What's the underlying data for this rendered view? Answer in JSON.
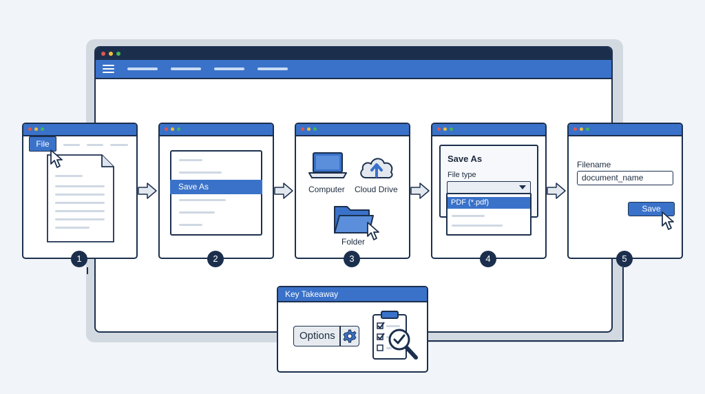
{
  "steps": [
    {
      "number": "1",
      "file_menu_label": "File"
    },
    {
      "number": "2",
      "menu_highlight": "Save As"
    },
    {
      "number": "3",
      "location_computer": "Computer",
      "location_cloud": "Cloud Drive",
      "location_folder": "Folder"
    },
    {
      "number": "4",
      "dialog_title": "Save As",
      "file_type_label": "File type",
      "selected_option": "PDF (*.pdf)"
    },
    {
      "number": "5",
      "filename_label": "Filename",
      "filename_value": "document_name",
      "save_button": "Save"
    }
  ],
  "takeaway": {
    "header": "Key Takeaway",
    "options_button": "Options"
  },
  "colors": {
    "navy": "#1b2f4d",
    "accent_blue": "#3a72c9",
    "page_background": "#f1f4f8"
  },
  "icons": [
    "hamburger-icon",
    "document-icon",
    "cursor-icon",
    "laptop-icon",
    "cloud-upload-icon",
    "folder-icon",
    "dropdown-caret-icon",
    "gear-icon",
    "checklist-clipboard-icon",
    "magnifier-check-icon",
    "arrow-right-icon"
  ]
}
